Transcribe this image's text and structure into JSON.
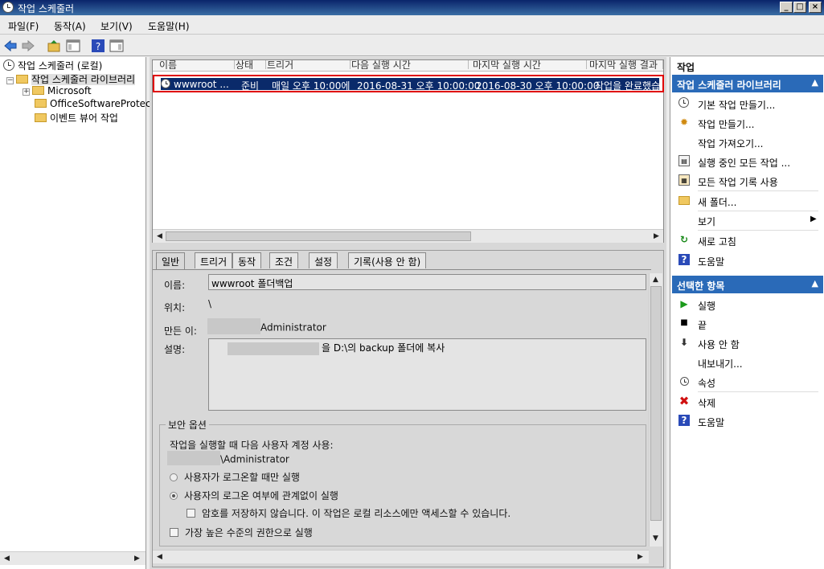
{
  "window": {
    "title": "작업 스케줄러",
    "controls": [
      "_",
      "□",
      "×"
    ]
  },
  "menu": [
    "파일(F)",
    "동작(A)",
    "보기(V)",
    "도움말(H)"
  ],
  "tree": {
    "root": "작업 스케줄러 (로컬)",
    "library": "작업 스케줄러 라이브러리",
    "children": [
      "Microsoft",
      "OfficeSoftwareProtec",
      "이벤트 뷰어 작업"
    ]
  },
  "task_list": {
    "columns": [
      "이름",
      "상태",
      "트리거",
      "다음 실행 시간",
      "마지막 실행 시간",
      "마지막 실행 결과"
    ],
    "rows": [
      {
        "name": "wwwroot ...",
        "status": "준비",
        "trigger": "매일 오후 10:00에",
        "next_run": "2016-08-31 오후 10:00:00",
        "last_run": "2016-08-30 오후 10:00:00",
        "result": "작업을 완료했습"
      }
    ]
  },
  "tabs": [
    "일반",
    "트리거",
    "동작",
    "조건",
    "설정",
    "기록(사용 안 함)"
  ],
  "general": {
    "name_label": "이름:",
    "name_value": "wwwroot 폴더백업",
    "location_label": "위치:",
    "location_value": "\\",
    "author_label": "만든 이:",
    "author_value": "Administrator",
    "desc_label": "설명:",
    "desc_value": "을 D:\\의 backup 폴더에 복사"
  },
  "security": {
    "legend": "보안 옵션",
    "account_label": "작업을 실행할 때 다음 사용자 계정 사용:",
    "account_value": "\\Administrator",
    "radio1": "사용자가 로그온할 때만 실행",
    "radio2": "사용자의 로그온 여부에 관계없이 실행",
    "check_pwd": "암호를 저장하지 않습니다. 이 작업은 로컬 리소스에만 액세스할 수 있습니다.",
    "check_highest": "가장 높은 수준의 권한으로 실행"
  },
  "actions_pane": {
    "title": "작업",
    "section1": "작업 스케줄러 라이브러리",
    "items1": [
      "기본 작업 만들기...",
      "작업 만들기...",
      "작업 가져오기...",
      "실행 중인 모든 작업 ...",
      "모든 작업 기록 사용",
      "새 폴더...",
      "보기",
      "새로 고침",
      "도움말"
    ],
    "section2": "선택한 항목",
    "items2": [
      "실행",
      "끝",
      "사용 안 함",
      "내보내기...",
      "속성",
      "삭제",
      "도움말"
    ]
  },
  "colors": {
    "selection": "#0a2a6a",
    "section_header": "#2a6ab8",
    "highlight_border": "#e00000",
    "delete": "#d01010"
  }
}
